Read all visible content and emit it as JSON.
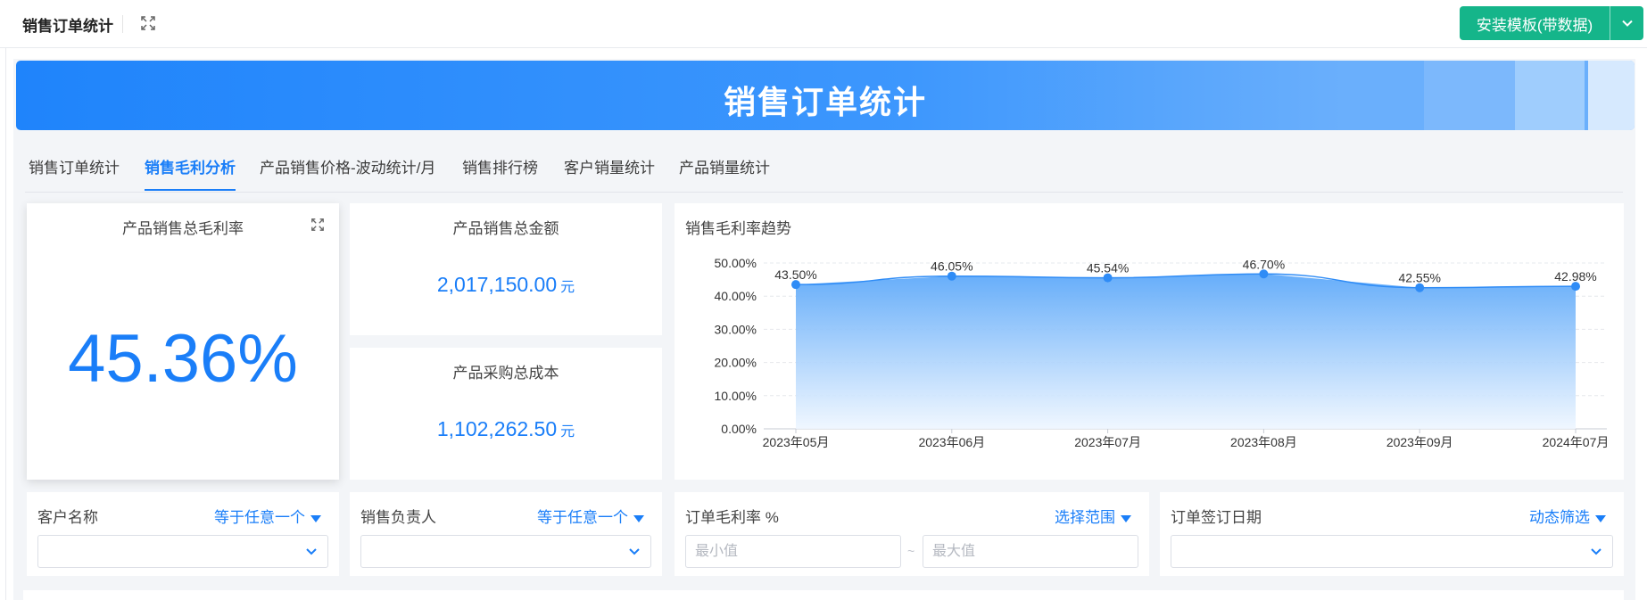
{
  "header": {
    "title": "销售订单统计",
    "install_button": "安装模板(带数据)"
  },
  "banner": {
    "title": "销售订单统计"
  },
  "tabs": [
    {
      "label": "销售订单统计",
      "active": false
    },
    {
      "label": "销售毛利分析",
      "active": true
    },
    {
      "label": "产品销售价格-波动统计/月",
      "active": false
    },
    {
      "label": "销售排行榜",
      "active": false
    },
    {
      "label": "客户销量统计",
      "active": false
    },
    {
      "label": "产品销量统计",
      "active": false
    }
  ],
  "kpis": {
    "gross_margin": {
      "title": "产品销售总毛利率",
      "value": "45.36%"
    },
    "total_sales": {
      "title": "产品销售总金额",
      "value": "2,017,150.00",
      "unit": "元"
    },
    "total_cost": {
      "title": "产品采购总成本",
      "value": "1,102,262.50",
      "unit": "元"
    }
  },
  "trend": {
    "title": "销售毛利率趋势"
  },
  "chart_data": {
    "type": "area",
    "title": "销售毛利率趋势",
    "categories": [
      "2023年05月",
      "2023年06月",
      "2023年07月",
      "2023年08月",
      "2023年09月",
      "2024年07月"
    ],
    "values": [
      43.5,
      46.05,
      45.54,
      46.7,
      42.55,
      42.98
    ],
    "value_labels": [
      "43.50%",
      "46.05%",
      "45.54%",
      "46.70%",
      "42.55%",
      "42.98%"
    ],
    "y_ticks": [
      "0.00%",
      "10.00%",
      "20.00%",
      "30.00%",
      "40.00%",
      "50.00%"
    ],
    "ylim": [
      0,
      50
    ],
    "grid": true,
    "colors": {
      "line": "#2f8cf6",
      "fill_top": "#5ea9f9",
      "fill_bottom": "#eef6ff"
    }
  },
  "filters": {
    "customer": {
      "label": "客户名称",
      "mode": "等于任意一个"
    },
    "owner": {
      "label": "销售负责人",
      "mode": "等于任意一个"
    },
    "margin": {
      "label": "订单毛利率 %",
      "mode": "选择范围",
      "min_placeholder": "最小值",
      "max_placeholder": "最大值",
      "separator": "~"
    },
    "date": {
      "label": "订单签订日期",
      "mode": "动态筛选"
    }
  },
  "colors": {
    "primary": "#1a7ef8",
    "install": "#15b58a",
    "banner_start": "#1f84fb",
    "banner_end": "#6aaffc"
  }
}
